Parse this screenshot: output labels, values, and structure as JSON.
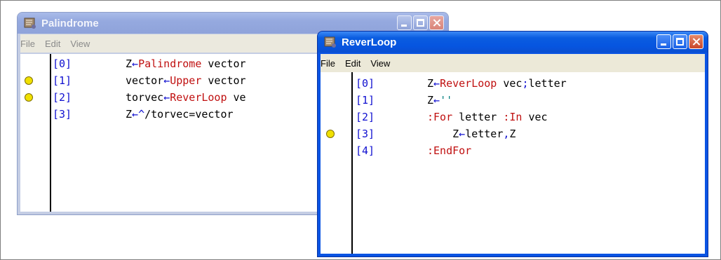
{
  "windows": {
    "palindrome": {
      "title": "Palindrome",
      "menu": [
        "File",
        "Edit",
        "View"
      ],
      "lines": [
        {
          "num": "[0]",
          "parts": [
            {
              "t": "Z",
              "c": "plain"
            },
            {
              "t": "←",
              "c": "op"
            },
            {
              "t": "Palindrome",
              "c": "kw"
            },
            {
              "t": " vector",
              "c": "plain"
            }
          ],
          "breakpoint": false
        },
        {
          "num": "[1]",
          "parts": [
            {
              "t": "vector",
              "c": "plain"
            },
            {
              "t": "←",
              "c": "op"
            },
            {
              "t": "Upper",
              "c": "kw"
            },
            {
              "t": " vector",
              "c": "plain"
            }
          ],
          "breakpoint": true
        },
        {
          "num": "[2]",
          "parts": [
            {
              "t": "torvec",
              "c": "plain"
            },
            {
              "t": "←",
              "c": "op"
            },
            {
              "t": "ReverLoop",
              "c": "kw"
            },
            {
              "t": " ve",
              "c": "plain"
            }
          ],
          "breakpoint": true
        },
        {
          "num": "[3]",
          "parts": [
            {
              "t": "Z",
              "c": "plain"
            },
            {
              "t": "←",
              "c": "op"
            },
            {
              "t": "^",
              "c": "op"
            },
            {
              "t": "/torvec=vector",
              "c": "plain"
            }
          ],
          "breakpoint": false
        }
      ]
    },
    "reverloop": {
      "title": "ReverLoop",
      "menu": [
        "File",
        "Edit",
        "View"
      ],
      "lines": [
        {
          "num": "[0]",
          "indent": "",
          "parts": [
            {
              "t": "Z",
              "c": "plain"
            },
            {
              "t": "←",
              "c": "op"
            },
            {
              "t": "ReverLoop",
              "c": "kw"
            },
            {
              "t": " vec",
              "c": "plain"
            },
            {
              "t": ";",
              "c": "op"
            },
            {
              "t": "letter",
              "c": "plain"
            }
          ],
          "breakpoint": false
        },
        {
          "num": "[1]",
          "indent": "",
          "parts": [
            {
              "t": "Z",
              "c": "plain"
            },
            {
              "t": "←",
              "c": "op"
            },
            {
              "t": "''",
              "c": "str"
            }
          ],
          "breakpoint": false
        },
        {
          "num": "[2]",
          "indent": "",
          "parts": [
            {
              "t": ":For",
              "c": "kw"
            },
            {
              "t": " letter ",
              "c": "plain"
            },
            {
              "t": ":In",
              "c": "kw"
            },
            {
              "t": " vec",
              "c": "plain"
            }
          ],
          "breakpoint": false
        },
        {
          "num": "[3]",
          "indent": "    ",
          "parts": [
            {
              "t": "Z",
              "c": "plain"
            },
            {
              "t": "←",
              "c": "op"
            },
            {
              "t": "letter",
              "c": "plain"
            },
            {
              "t": ",",
              "c": "op"
            },
            {
              "t": "Z",
              "c": "plain"
            }
          ],
          "breakpoint": true
        },
        {
          "num": "[4]",
          "indent": "",
          "parts": [
            {
              "t": ":EndFor",
              "c": "kw"
            }
          ],
          "breakpoint": false
        }
      ]
    }
  },
  "colors": {
    "line_number": "#1010d0",
    "keyword": "#c01010",
    "string": "#008080",
    "breakpoint": "#f0e000"
  },
  "icons": {
    "app_icon": "function-editor-icon",
    "minimize": "minimize-icon",
    "maximize": "maximize-icon",
    "close": "close-icon"
  }
}
